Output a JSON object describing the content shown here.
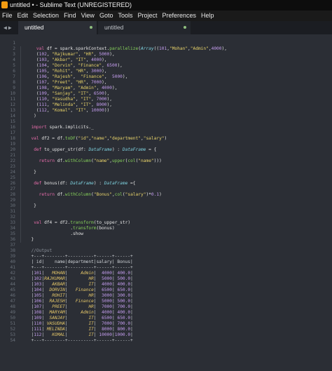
{
  "window": {
    "title": "untitled • - Sublime Text (UNREGISTERED)"
  },
  "menu": [
    "File",
    "Edit",
    "Selection",
    "Find",
    "View",
    "Goto",
    "Tools",
    "Project",
    "Preferences",
    "Help"
  ],
  "tabs": [
    {
      "label": "untitled",
      "active": true,
      "modified": true
    },
    {
      "label": "untitled",
      "active": false,
      "modified": true
    }
  ],
  "colors": {
    "background": "#2b2e35",
    "keyword": "#e66caa",
    "type": "#7fd3e0",
    "string": "#e8d36a",
    "number": "#c49dee",
    "function": "#86d05a"
  },
  "editor": {
    "lines": [
      "",
      "    val df = spark.sparkContext.parallelize(Array((101,\"Mohan\",\"Admin\",4000),",
      "    (102, \"Rajkumar\", \"HR\", 5000),",
      "    (103, \"Akbar\", \"IT\", 4000),",
      "    (104, \"Dorvin\", \"Finance\", 6500),",
      "    (105, \"Rohit\", \"HR\", 3000),",
      "    (106, \"Rajesh\",  \"Finance\",  5000),",
      "    (107, \"Preet\", \"HR\", 7000),",
      "    (108, \"Maryam\", \"Admin\", 4000),",
      "    (109, \"Sanjay\", \"IT\", 6500),",
      "    (110, \"Vasudha\", \"IT\", 7000),",
      "    (111, \"Melinda\", \"IT\", 8000),",
      "    (112, \"Komal\", \"IT\", 10000))",
      "   )",
      "",
      "  import spark.implicits._",
      "",
      "  val df2 = df.toDF(\"id\",\"name\",\"department\",\"salary\")",
      "",
      "   def to_upper_str(df: DataFrame) : DataFrame = {",
      "",
      "     return df.withColumn(\"name\",upper(col(\"name\")))",
      "",
      "   }",
      "",
      "   def bonus(df: DataFrame) : DataFrame ={",
      "",
      "     return df.withColumn(\"Bonus\",col(\"salary\")*0.1)",
      "",
      "   }",
      "",
      "",
      "   val df4 = df2.transform(to_upper_str)",
      "                 .transform(bonus)",
      "                 .show",
      "  }",
      "",
      "  //Output",
      "  +---+--------+----------+------+------+",
      "  | id|    name|department|salary| Bonus|",
      "  +---+--------+----------+------+------+",
      "  |101|   MOHAN|     Admin|  4000| 400.0|",
      "  |102|RAJKUMAR|        HR|  5000| 500.0|",
      "  |103|   AKBAR|        IT|  4000| 400.0|",
      "  |104|  DORVIN|   Finance|  6500| 650.0|",
      "  |105|   ROHIT|        HR|  3000| 300.0|",
      "  |106|  RAJESH|   Finance|  5000| 500.0|",
      "  |107|   PREET|        HR|  7000| 700.0|",
      "  |108|  MARYAM|     Admin|  4000| 400.0|",
      "  |109|  SANJAY|        IT|  6500| 650.0|",
      "  |110| VASUDHA|        IT|  7000| 700.0|",
      "  |111| MELINDA|        IT|  8000| 800.0|",
      "  |112|   KOMAL|        IT| 10000|1000.0|",
      "  +---+--------+----------+------+------+"
    ]
  }
}
